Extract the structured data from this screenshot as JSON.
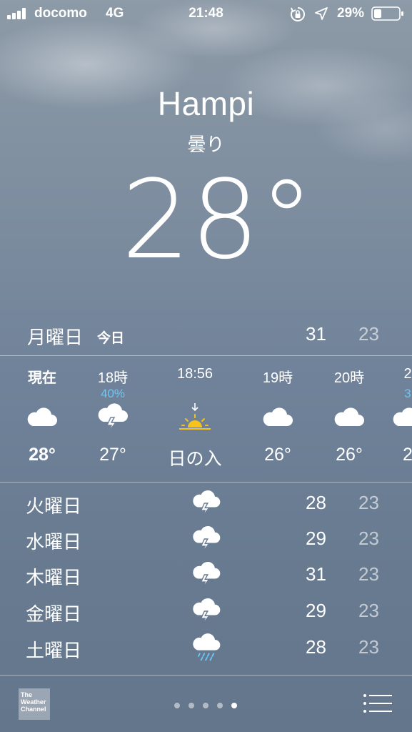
{
  "status_bar": {
    "carrier": "docomo",
    "network": "4G",
    "time": "21:48",
    "battery_percent": "29%"
  },
  "location": {
    "city": "Hampi",
    "condition": "曇り",
    "temperature": "28°"
  },
  "today": {
    "day": "月曜日",
    "label": "今日",
    "high": "31",
    "low": "23"
  },
  "hourly": [
    {
      "time": "現在",
      "precip": "",
      "icon": "cloud-icon",
      "temp": "28°"
    },
    {
      "time": "18時",
      "precip": "40%",
      "icon": "thunderstorm-icon",
      "temp": "27°"
    },
    {
      "time": "18:56",
      "precip": "",
      "icon": "sunset-icon",
      "temp": "日の入"
    },
    {
      "time": "19時",
      "precip": "",
      "icon": "cloud-icon",
      "temp": "26°"
    },
    {
      "time": "20時",
      "precip": "",
      "icon": "cloud-icon",
      "temp": "26°"
    },
    {
      "time": "2",
      "precip": "3",
      "icon": "cloud-icon",
      "temp": "2"
    }
  ],
  "daily": [
    {
      "day": "火曜日",
      "icon": "thunderstorm-icon",
      "high": "28",
      "low": "23"
    },
    {
      "day": "水曜日",
      "icon": "thunderstorm-icon",
      "high": "29",
      "low": "23"
    },
    {
      "day": "木曜日",
      "icon": "thunderstorm-icon",
      "high": "31",
      "low": "23"
    },
    {
      "day": "金曜日",
      "icon": "thunderstorm-icon",
      "high": "29",
      "low": "23"
    },
    {
      "day": "土曜日",
      "icon": "rain-icon",
      "high": "28",
      "low": "23"
    }
  ],
  "footer": {
    "logo_text": [
      "The",
      "Weather",
      "Channel"
    ],
    "page_count": 5,
    "active_page": 5
  },
  "colors": {
    "precip_blue": "#6cc7f5",
    "sun_yellow": "#f7c21a"
  }
}
